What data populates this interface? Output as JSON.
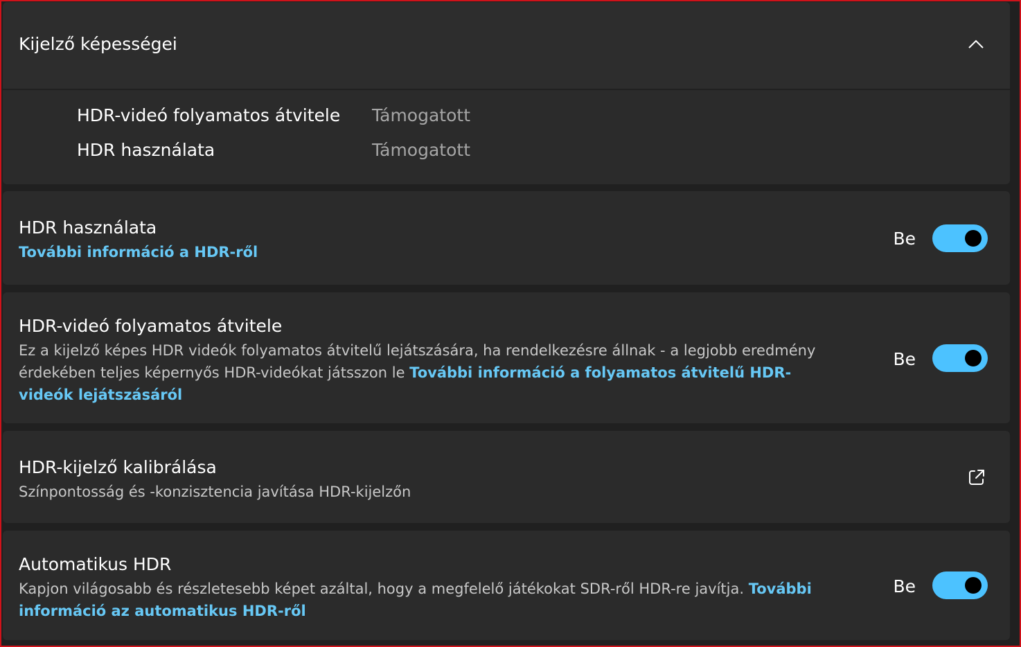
{
  "capabilities": {
    "title": "Kijelző képességei",
    "rows": [
      {
        "label": "HDR-videó folyamatos átvitele",
        "value": "Támogatott"
      },
      {
        "label": "HDR használata",
        "value": "Támogatott"
      }
    ]
  },
  "settings": {
    "use_hdr": {
      "title": "HDR használata",
      "link": "További információ a HDR-ről",
      "state": "Be",
      "enabled": true
    },
    "hdr_video": {
      "title": "HDR-videó folyamatos átvitele",
      "description": "Ez a kijelző képes HDR videók folyamatos átvitelű lejátszására, ha rendelkezésre állnak -  a legjobb eredmény érdekében teljes képernyős HDR-videókat játsszon le ",
      "link": "További információ a folyamatos átvitelű HDR-videók lejátszásáról",
      "state": "Be",
      "enabled": true
    },
    "calibration": {
      "title": "HDR-kijelző kalibrálása",
      "description": "Színpontosság és -konzisztencia javítása HDR-kijelzőn",
      "icon": "external-link-icon"
    },
    "auto_hdr": {
      "title": "Automatikus HDR",
      "description": "Kapjon világosabb és részletesebb képet azáltal, hogy a megfelelő játékokat SDR-ről HDR-re javítja. ",
      "link": "További információ az automatikus HDR-ről",
      "state": "Be",
      "enabled": true
    }
  },
  "colors": {
    "accent": "#4cc2ff",
    "link": "#67c8f5",
    "background": "#202020",
    "card": "#2b2b2b"
  }
}
